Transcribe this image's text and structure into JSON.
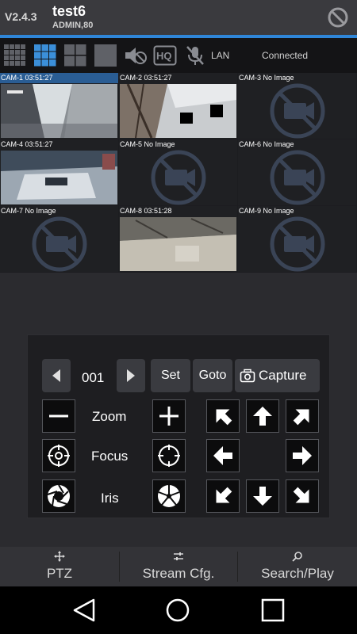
{
  "header": {
    "version": "V2.4.3",
    "title": "test6",
    "subtitle": "ADMIN,80"
  },
  "toolbar": {
    "hq_label": "HQ",
    "network": "LAN",
    "status": "Connected",
    "layouts": [
      "grid-4x4-icon",
      "grid-3x3-icon",
      "grid-2x2-icon",
      "grid-1x1-icon"
    ]
  },
  "cameras": [
    {
      "label": "CAM-1  03:51:27",
      "has_image": true
    },
    {
      "label": "CAM-2  03:51:27",
      "has_image": true
    },
    {
      "label": "CAM-3 No Image",
      "has_image": false
    },
    {
      "label": "CAM-4  03:51:27",
      "has_image": true
    },
    {
      "label": "CAM-5 No Image",
      "has_image": false
    },
    {
      "label": "CAM-6 No Image",
      "has_image": false
    },
    {
      "label": "CAM-7 No Image",
      "has_image": false
    },
    {
      "label": "CAM-8  03:51:28",
      "has_image": true
    },
    {
      "label": "CAM-9 No Image",
      "has_image": false
    }
  ],
  "ptz": {
    "preset": "001",
    "set_label": "Set",
    "goto_label": "Goto",
    "capture_label": "Capture",
    "zoom_label": "Zoom",
    "focus_label": "Focus",
    "iris_label": "Iris"
  },
  "tabs": {
    "ptz": "PTZ",
    "stream": "Stream Cfg.",
    "search": "Search/Play"
  },
  "colors": {
    "accent": "#2f86d8",
    "selected_header": "#2a5d94"
  }
}
